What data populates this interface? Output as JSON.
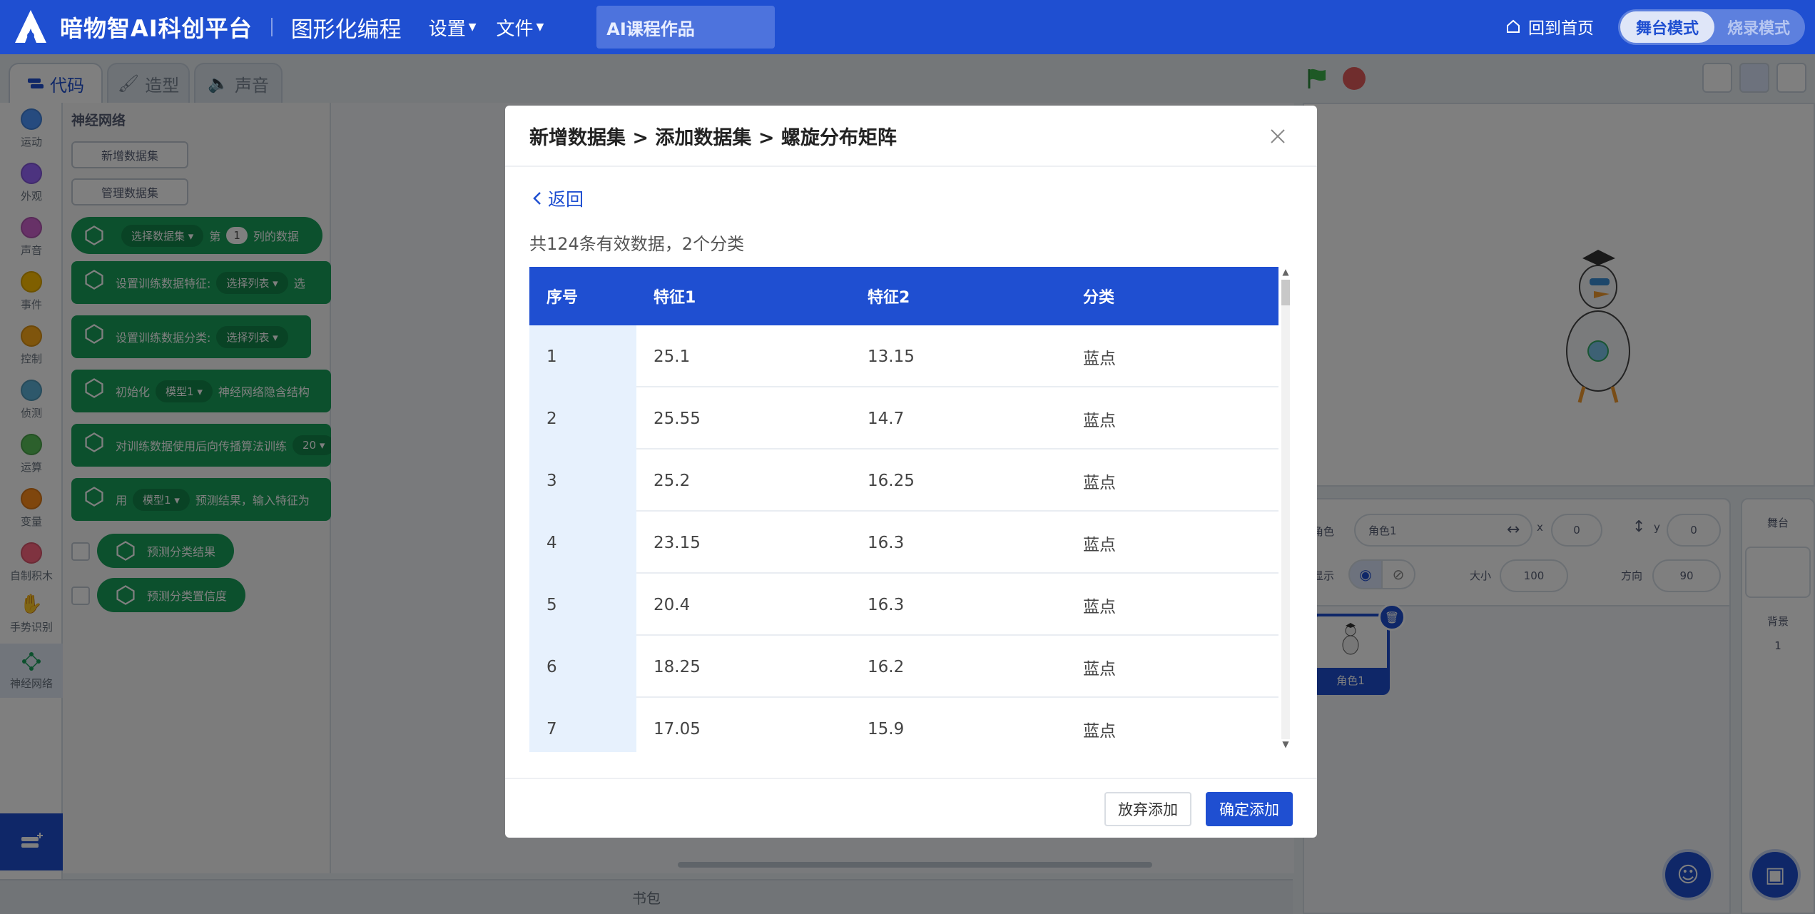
{
  "app": {
    "brand": "暗物智AI科创平台",
    "mode_title": "图形化编程",
    "menus": [
      "设置",
      "文件"
    ],
    "project_name": "AI课程作品",
    "home_link": "回到首页",
    "mode_switch": {
      "active": "舞台模式",
      "inactive": "烧录模式"
    },
    "accent_color": "#1f4fd1"
  },
  "tabs": [
    {
      "label": "代码",
      "icon": "code-icon"
    },
    {
      "label": "造型",
      "icon": "brush-icon"
    },
    {
      "label": "声音",
      "icon": "speaker-icon"
    }
  ],
  "categories": [
    {
      "label": "运动",
      "color": "#4c97ff"
    },
    {
      "label": "外观",
      "color": "#9966ff"
    },
    {
      "label": "声音",
      "color": "#cf63cf"
    },
    {
      "label": "事件",
      "color": "#ffbf00"
    },
    {
      "label": "控制",
      "color": "#ffab19"
    },
    {
      "label": "侦测",
      "color": "#5cb1d6"
    },
    {
      "label": "运算",
      "color": "#59c059"
    },
    {
      "label": "变量",
      "color": "#ff8c1a"
    },
    {
      "label": "自制积木",
      "color": "#ff6680"
    },
    {
      "label": "手势识别",
      "color": ""
    },
    {
      "label": "神经网络",
      "color": ""
    }
  ],
  "palette": {
    "title": "神经网络",
    "buttons": [
      "新增数据集",
      "管理数据集"
    ],
    "blocks": [
      {
        "parts": [
          "选择数据集 ▾",
          "第",
          "1",
          "列的数据"
        ]
      },
      {
        "parts": [
          "设置训练数据特征:",
          "选择列表 ▾",
          "选"
        ]
      },
      {
        "parts": [
          "设置训练数据分类:",
          "选择列表 ▾"
        ]
      },
      {
        "parts": [
          "初始化",
          "模型1 ▾",
          "神经网络隐含结构"
        ]
      },
      {
        "parts": [
          "对训练数据使用后向传播算法训练",
          "20 ▾"
        ]
      },
      {
        "parts": [
          "用",
          "模型1 ▾",
          "预测结果，输入特征为"
        ]
      }
    ],
    "reporters": [
      "预测分类结果",
      "预测分类置信度"
    ]
  },
  "backpack_label": "书包",
  "sprite_info": {
    "sprite_label": "角色",
    "sprite_name": "角色1",
    "x_label": "x",
    "x_value": "0",
    "y_label": "y",
    "y_value": "0",
    "show_label": "显示",
    "size_label": "大小",
    "size_value": "100",
    "direction_label": "方向",
    "direction_value": "90",
    "sprite_thumb_name": "角色1"
  },
  "backdrop": {
    "title": "舞台",
    "label": "背景",
    "count": "1"
  },
  "modal": {
    "title": "新增数据集 > 添加数据集 > 螺旋分布矩阵",
    "back_label": "返回",
    "summary": "共124条有效数据，2个分类",
    "columns": [
      "序号",
      "特征1",
      "特征2",
      "分类"
    ],
    "rows": [
      [
        "1",
        "25.1",
        "13.15",
        "蓝点"
      ],
      [
        "2",
        "25.55",
        "14.7",
        "蓝点"
      ],
      [
        "3",
        "25.2",
        "16.25",
        "蓝点"
      ],
      [
        "4",
        "23.15",
        "16.3",
        "蓝点"
      ],
      [
        "5",
        "20.4",
        "16.3",
        "蓝点"
      ],
      [
        "6",
        "18.25",
        "16.2",
        "蓝点"
      ],
      [
        "7",
        "17.05",
        "15.9",
        "蓝点"
      ]
    ],
    "cancel_label": "放弃添加",
    "confirm_label": "确定添加"
  }
}
